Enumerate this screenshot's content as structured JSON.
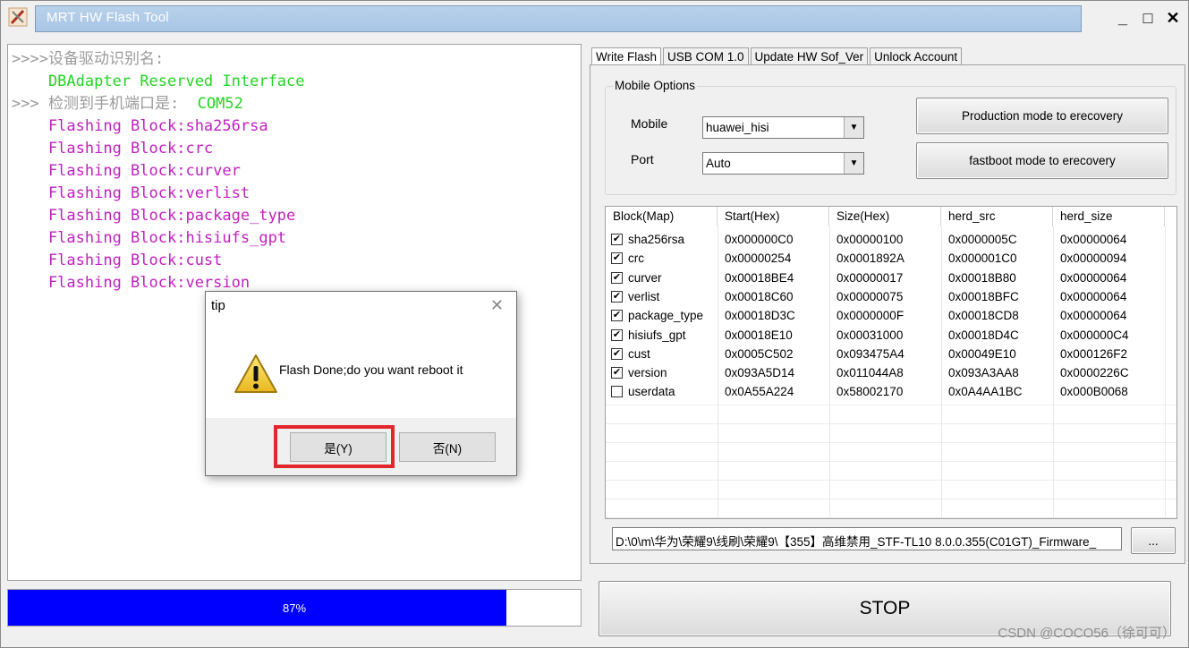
{
  "window": {
    "title": "MRT HW Flash Tool",
    "controls": {
      "minimize": "_",
      "maximize": "□",
      "close": "✕"
    }
  },
  "log": {
    "lines": [
      {
        "text": ">>>>设备驱动识别名:",
        "color": "gray"
      },
      {
        "text": "    DBAdapter Reserved Interface",
        "color": "green"
      },
      {
        "text_prefix": ">>> 检测到手机端口是:  ",
        "text_suffix": "COM52",
        "color": "mixed"
      },
      {
        "text": "    Flashing Block:sha256rsa",
        "color": "magenta"
      },
      {
        "text": "    Flashing Block:crc",
        "color": "magenta"
      },
      {
        "text": "    Flashing Block:curver",
        "color": "magenta"
      },
      {
        "text": "    Flashing Block:verlist",
        "color": "magenta"
      },
      {
        "text": "    Flashing Block:package_type",
        "color": "magenta"
      },
      {
        "text": "    Flashing Block:hisiufs_gpt",
        "color": "magenta"
      },
      {
        "text": "    Flashing Block:cust",
        "color": "magenta"
      },
      {
        "text": "    Flashing Block:version",
        "color": "magenta"
      }
    ]
  },
  "progress": {
    "label": "87%",
    "value": 0.87,
    "color": "#0000ff"
  },
  "tabs": [
    "Write Flash",
    "USB COM 1.0",
    "Update HW Sof_Ver",
    "Unlock Account"
  ],
  "mobile_options": {
    "title": "Mobile Options",
    "mobile_label": "Mobile",
    "mobile_value": "huawei_hisi",
    "port_label": "Port",
    "port_value": "Auto",
    "production_button": "Production mode to erecovery",
    "fastboot_button": "fastboot mode to erecovery"
  },
  "table": {
    "columns": [
      "Block(Map)",
      "Start(Hex)",
      "Size(Hex)",
      "herd_src",
      "herd_size"
    ],
    "rows": [
      {
        "checked": true,
        "cells": [
          "sha256rsa",
          "0x000000C0",
          "0x00000100",
          "0x0000005C",
          "0x00000064"
        ]
      },
      {
        "checked": true,
        "cells": [
          "crc",
          "0x00000254",
          "0x0001892A",
          "0x000001C0",
          "0x00000094"
        ]
      },
      {
        "checked": true,
        "cells": [
          "curver",
          "0x00018BE4",
          "0x00000017",
          "0x00018B80",
          "0x00000064"
        ]
      },
      {
        "checked": true,
        "cells": [
          "verlist",
          "0x00018C60",
          "0x00000075",
          "0x00018BFC",
          "0x00000064"
        ]
      },
      {
        "checked": true,
        "cells": [
          "package_type",
          "0x00018D3C",
          "0x0000000F",
          "0x00018CD8",
          "0x00000064"
        ]
      },
      {
        "checked": true,
        "cells": [
          "hisiufs_gpt",
          "0x00018E10",
          "0x00031000",
          "0x00018D4C",
          "0x000000C4"
        ]
      },
      {
        "checked": true,
        "cells": [
          "cust",
          "0x0005C502",
          "0x093475A4",
          "0x00049E10",
          "0x000126F2"
        ]
      },
      {
        "checked": true,
        "cells": [
          "version",
          "0x093A5D14",
          "0x011044A8",
          "0x093A3AA8",
          "0x0000226C"
        ]
      },
      {
        "checked": false,
        "cells": [
          "userdata",
          "0x0A55A224",
          "0x58002170",
          "0x0A4AA1BC",
          "0x000B0068"
        ]
      }
    ]
  },
  "firmware_path": "D:\\0\\m\\华为\\荣耀9\\线刷\\荣耀9\\【355】高维禁用_STF-TL10 8.0.0.355(C01GT)_Firmware_",
  "browse_button": "...",
  "stop_button": "STOP",
  "watermark": "CSDN @COCO56（徐可可）",
  "dialog": {
    "title": "tip",
    "close": "✕",
    "message": "Flash Done;do you want reboot it",
    "yes_button": "是(Y)",
    "no_button": "否(N)",
    "highlight_color": "#e2262b"
  }
}
